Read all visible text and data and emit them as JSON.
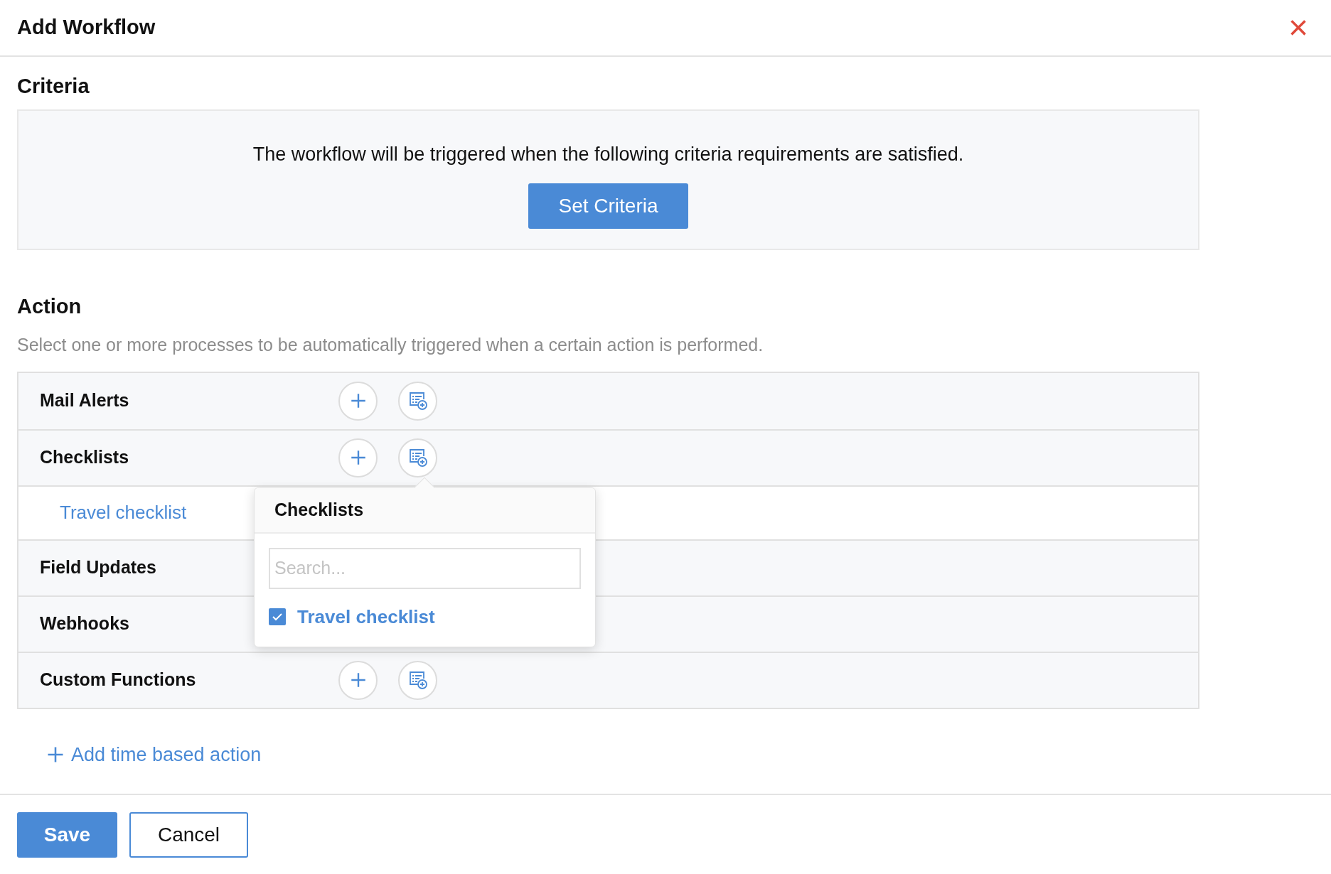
{
  "dialog": {
    "title": "Add Workflow",
    "close": "×"
  },
  "criteria": {
    "heading": "Criteria",
    "message": "The workflow will be triggered when the following criteria requirements are satisfied.",
    "button": "Set Criteria"
  },
  "action": {
    "heading": "Action",
    "description": "Select one or more processes to be automatically triggered when a certain action is performed.",
    "rows": [
      {
        "label": "Mail Alerts",
        "children": []
      },
      {
        "label": "Checklists",
        "children": [
          {
            "label": "Travel checklist"
          }
        ],
        "popover": {
          "title": "Checklists",
          "search": {
            "placeholder": "Search..."
          },
          "options": [
            {
              "label": "Travel checklist",
              "checked": true
            }
          ]
        }
      },
      {
        "label": "Field Updates",
        "children": []
      },
      {
        "label": "Webhooks",
        "children": []
      },
      {
        "label": "Custom Functions",
        "children": []
      }
    ],
    "add_time_action": "Add time based action"
  },
  "footer": {
    "buttons": [
      {
        "label": "Save",
        "kind": "primary"
      },
      {
        "label": "Cancel",
        "kind": "secondary"
      }
    ]
  }
}
